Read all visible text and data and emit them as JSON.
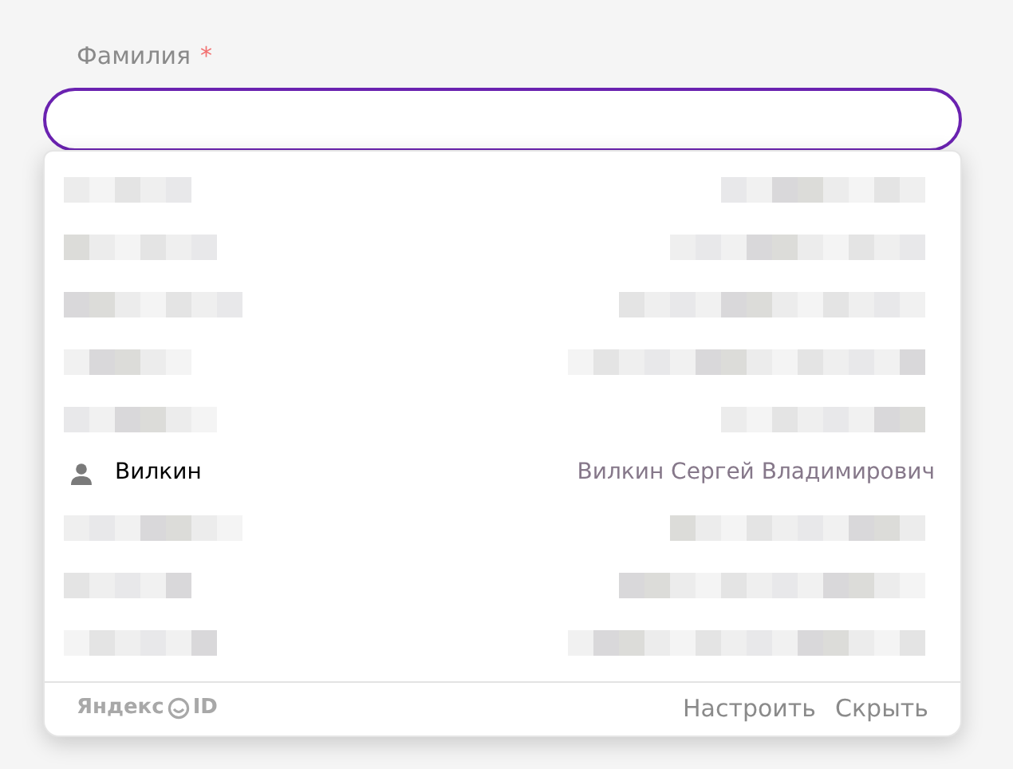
{
  "field": {
    "label": "Фамилия",
    "required_mark": "*",
    "focused": true
  },
  "suggestions": [
    {
      "kind": "redacted"
    },
    {
      "kind": "redacted"
    },
    {
      "kind": "redacted"
    },
    {
      "kind": "redacted"
    },
    {
      "kind": "redacted"
    },
    {
      "kind": "person",
      "short": "Вилкин",
      "full": "Вилкин Сергей Владимирович"
    },
    {
      "kind": "redacted"
    },
    {
      "kind": "redacted"
    },
    {
      "kind": "redacted"
    }
  ],
  "footer": {
    "logo": "Яндекс",
    "logo_suffix": "ID",
    "links": [
      "Настроить",
      "Скрыть"
    ]
  }
}
